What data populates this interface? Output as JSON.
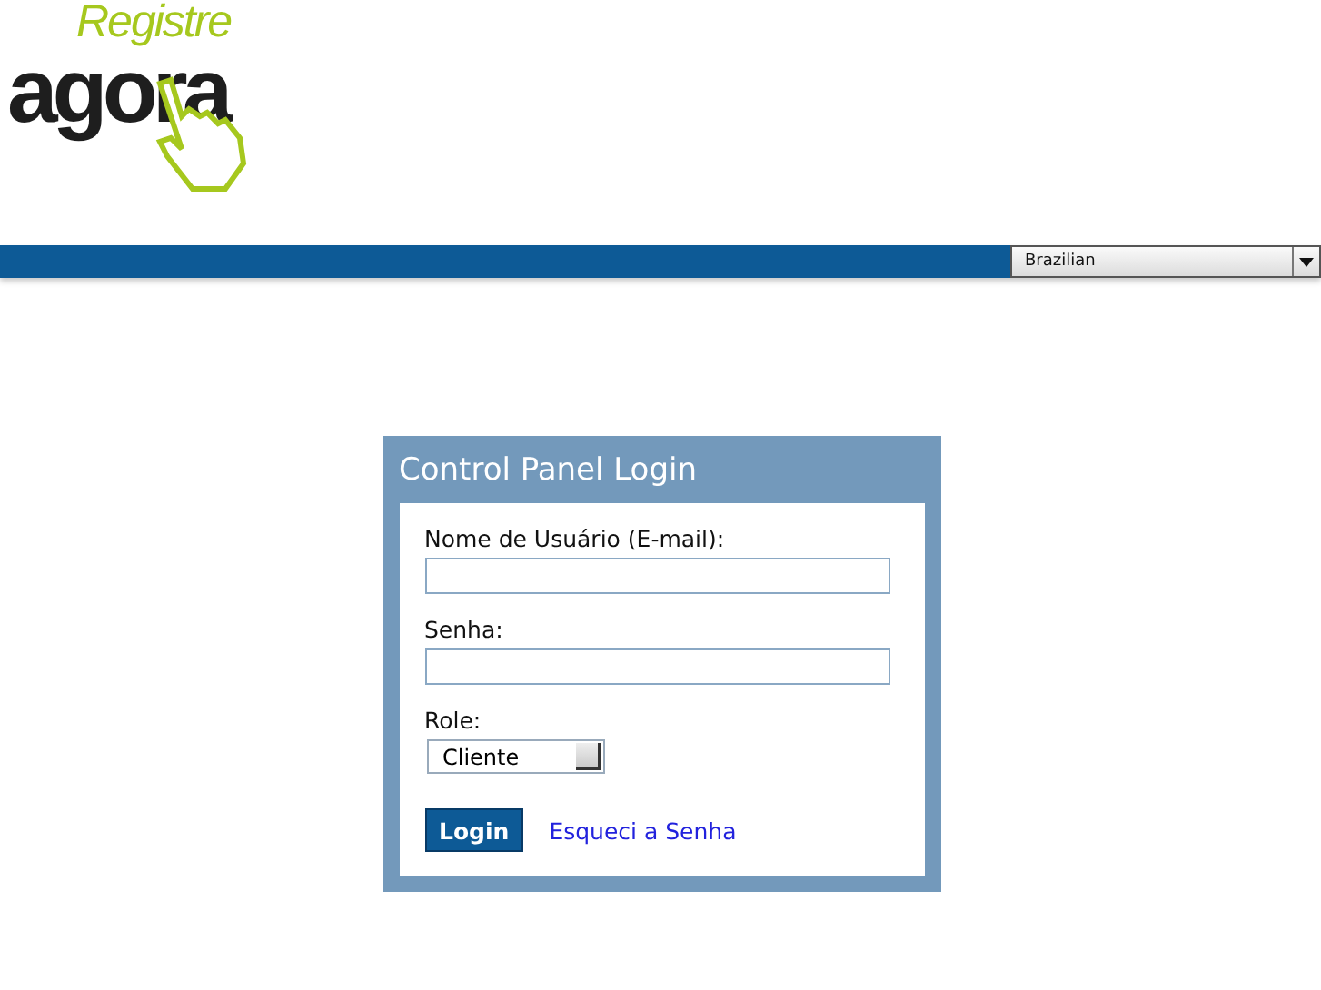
{
  "logo": {
    "top": "Registre",
    "bottom": "agora"
  },
  "language_select": {
    "value": "Brazilian"
  },
  "login_panel": {
    "title": "Control Panel Login",
    "fields": [
      {
        "label": "Nome de Usuário (E-mail):"
      },
      {
        "label": "Senha:"
      }
    ],
    "role": {
      "label": "Role:",
      "value": "Cliente"
    },
    "login_button": "Login",
    "forgot_link": "Esqueci a Senha"
  }
}
